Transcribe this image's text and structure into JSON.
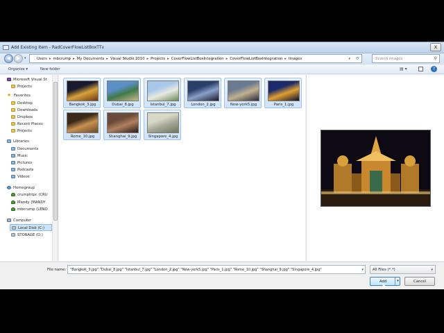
{
  "window": {
    "title": "Add Existing Item - RadCoverFlowListBoxTTv",
    "close_label": "x"
  },
  "address": {
    "crumbs": [
      "Users",
      "mbcrump",
      "My Documents",
      "Visual Studio 2010",
      "Projects",
      "CoverFlowListBoxIntegration",
      "CoverFlowListBoxIntegration",
      "Images"
    ],
    "separator": "▸",
    "search_placeholder": "Search Images"
  },
  "toolbar": {
    "organize_label": "Organize ▾",
    "new_folder_label": "New folder"
  },
  "nav": {
    "items": [
      {
        "label": "Microsoft Visual St",
        "icon": "vs-icon",
        "kind": "vs"
      },
      {
        "label": "Projects",
        "icon": "folder-icon",
        "kind": "folder"
      },
      {
        "label": "Favorites",
        "icon": "star-icon",
        "kind": "star"
      },
      {
        "label": "Desktop",
        "icon": "folder-icon",
        "kind": "folder"
      },
      {
        "label": "Downloads",
        "icon": "folder-icon",
        "kind": "folder"
      },
      {
        "label": "Dropbox",
        "icon": "folder-icon",
        "kind": "folder"
      },
      {
        "label": "Recent Places",
        "icon": "folder-icon",
        "kind": "folder"
      },
      {
        "label": "Projects",
        "icon": "folder-icon",
        "kind": "folder"
      },
      {
        "label": "Libraries",
        "icon": "library-icon",
        "kind": "lib"
      },
      {
        "label": "Documents",
        "icon": "library-icon",
        "kind": "lib"
      },
      {
        "label": "Music",
        "icon": "library-icon",
        "kind": "lib"
      },
      {
        "label": "Pictures",
        "icon": "library-icon",
        "kind": "lib"
      },
      {
        "label": "Podcasts",
        "icon": "library-icon",
        "kind": "lib"
      },
      {
        "label": "Videos",
        "icon": "library-icon",
        "kind": "lib"
      },
      {
        "label": "Homegroup",
        "icon": "homegroup-icon",
        "kind": "home"
      },
      {
        "label": "crumphtpc (CRU",
        "icon": "user-icon",
        "kind": "user"
      },
      {
        "label": "Mandy (MANDY",
        "icon": "user-icon",
        "kind": "user"
      },
      {
        "label": "mbcrump (LENO",
        "icon": "user-icon",
        "kind": "user"
      },
      {
        "label": "Computer",
        "icon": "computer-icon",
        "kind": "comp"
      },
      {
        "label": "Local Disk (C:)",
        "icon": "disk-icon",
        "kind": "disk",
        "selected": true
      },
      {
        "label": "STORAGE (D:)",
        "icon": "disk-icon",
        "kind": "disk"
      }
    ]
  },
  "files": [
    {
      "name": "Bangkok_3.jpg",
      "palette": [
        "#1a1a2e",
        "#d9a13a",
        "#6b3a12"
      ]
    },
    {
      "name": "Dubai_8.jpg",
      "palette": [
        "#5c8fc7",
        "#3f7a4a",
        "#c9b78a"
      ]
    },
    {
      "name": "Istanbul_7.jpg",
      "palette": [
        "#a8c8ea",
        "#e8e8e0",
        "#6a8a5a"
      ]
    },
    {
      "name": "London_2.jpg",
      "palette": [
        "#2a3f6a",
        "#8aa0c8",
        "#1a1a2a"
      ]
    },
    {
      "name": "New-york5.jpg",
      "palette": [
        "#6a7a90",
        "#c0b090",
        "#2a2a3a"
      ]
    },
    {
      "name": "Paris_1.jpg",
      "palette": [
        "#1a2a6a",
        "#e0a030",
        "#0a1030"
      ]
    },
    {
      "name": "Rome_10.jpg",
      "palette": [
        "#3a2a1a",
        "#c89050",
        "#6a4a2a"
      ]
    },
    {
      "name": "Shanghai_9.jpg",
      "palette": [
        "#6a4a3a",
        "#b08060",
        "#2a1a1a"
      ]
    },
    {
      "name": "Singapore_4.jpg",
      "palette": [
        "#d8d8c8",
        "#a8a898",
        "#6a7a5a"
      ]
    }
  ],
  "bottom": {
    "filename_label": "File name:",
    "filename_value": "\"Bangkok_3.jpg\" \"Dubai_8.jpg\" \"Istanbul_7.jpg\" \"London_2.jpg\" \"New-york5.jpg\" \"Paris_1.jpg\" \"Rome_10.jpg\" \"Shanghai_9.jpg\" \"Singapore_4.jpg\"",
    "filter_value": "All Files (*.*)",
    "add_label": "Add",
    "cancel_label": "Cancel"
  }
}
